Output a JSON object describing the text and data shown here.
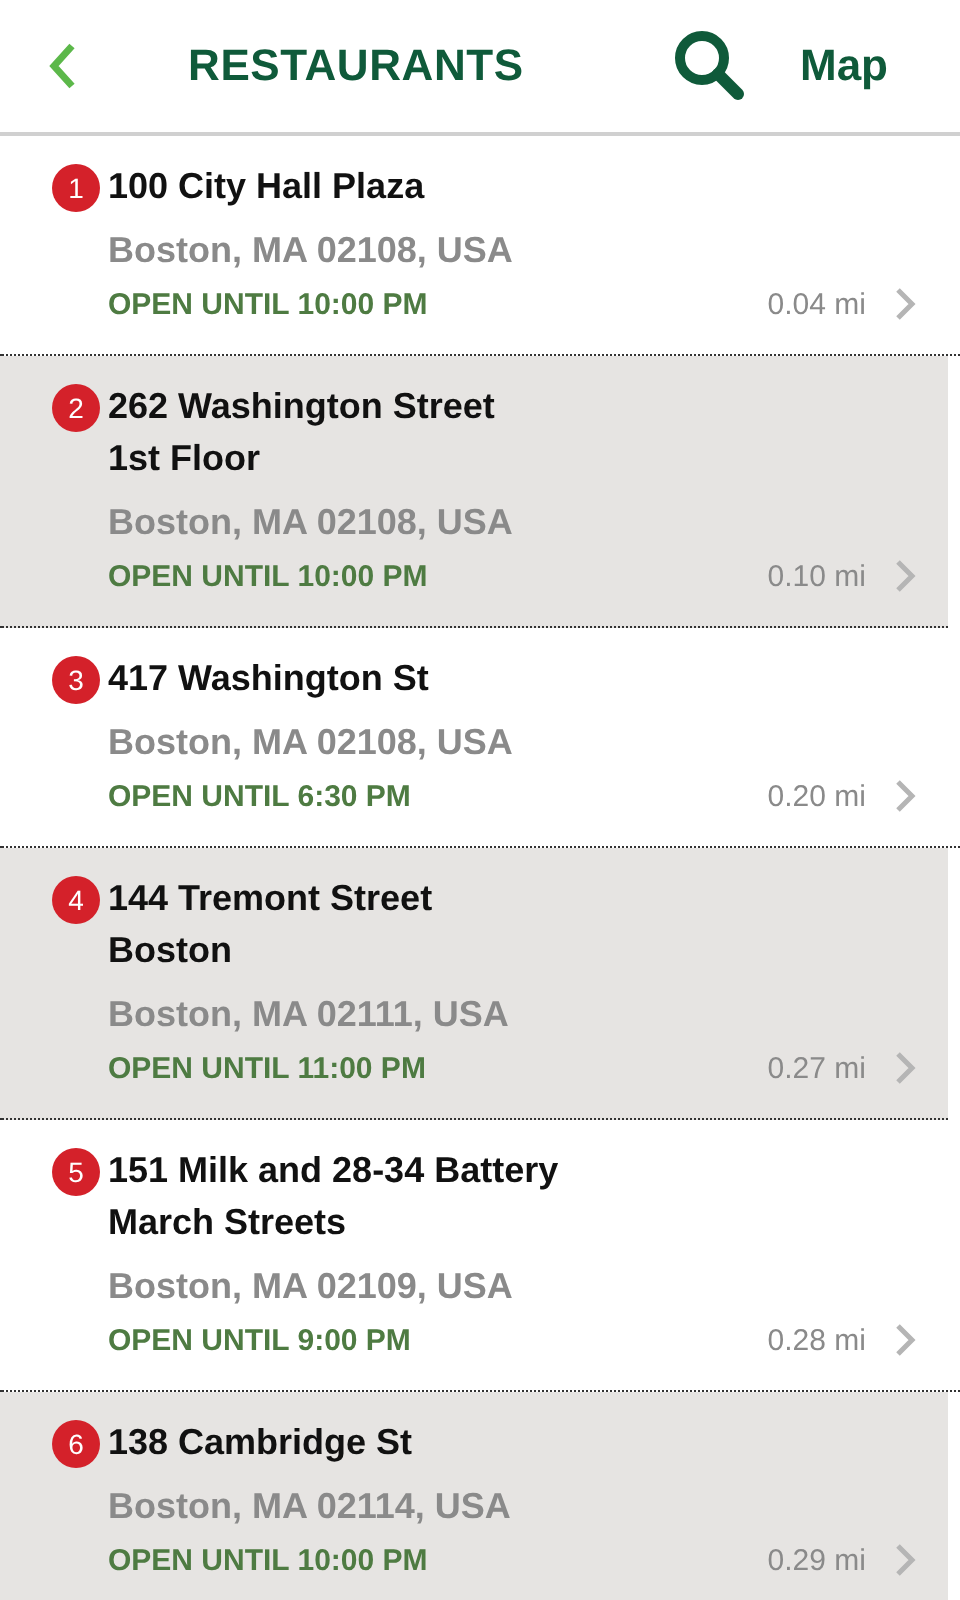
{
  "header": {
    "title": "RESTAURANTS",
    "map": "Map"
  },
  "locations": [
    {
      "number": "1",
      "address_lines": [
        "100 City Hall Plaza"
      ],
      "city": "Boston, MA 02108, USA",
      "hours": "OPEN UNTIL 10:00 PM",
      "distance": "0.04 mi"
    },
    {
      "number": "2",
      "address_lines": [
        "262 Washington Street",
        "1st Floor"
      ],
      "city": "Boston, MA 02108, USA",
      "hours": "OPEN UNTIL 10:00 PM",
      "distance": "0.10 mi"
    },
    {
      "number": "3",
      "address_lines": [
        "417 Washington St"
      ],
      "city": "Boston, MA 02108, USA",
      "hours": "OPEN UNTIL 6:30 PM",
      "distance": "0.20 mi"
    },
    {
      "number": "4",
      "address_lines": [
        "144 Tremont Street",
        "Boston"
      ],
      "city": "Boston, MA 02111, USA",
      "hours": "OPEN UNTIL 11:00 PM",
      "distance": "0.27 mi"
    },
    {
      "number": "5",
      "address_lines": [
        "151 Milk and 28-34 Battery",
        "March Streets"
      ],
      "city": "Boston, MA 02109, USA",
      "hours": "OPEN UNTIL 9:00 PM",
      "distance": "0.28 mi"
    },
    {
      "number": "6",
      "address_lines": [
        "138 Cambridge St"
      ],
      "city": "Boston, MA 02114, USA",
      "hours": "OPEN UNTIL 10:00 PM",
      "distance": "0.29 mi"
    }
  ]
}
